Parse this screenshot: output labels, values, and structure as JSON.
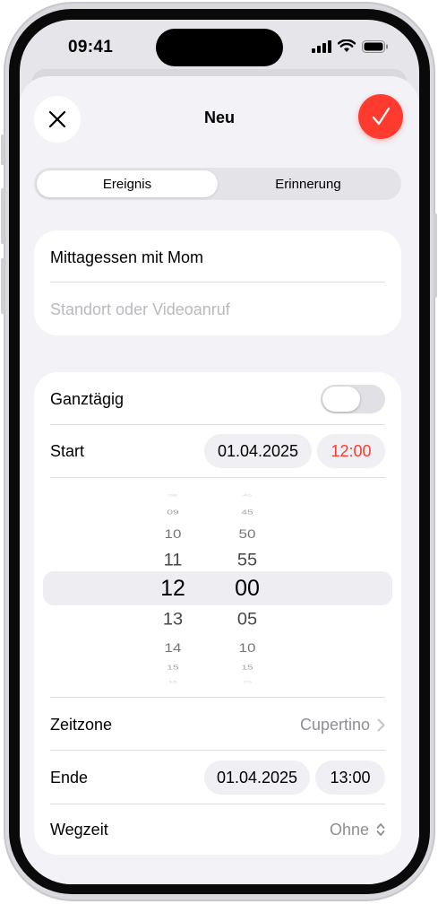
{
  "status": {
    "time": "09:41"
  },
  "nav": {
    "title": "Neu"
  },
  "segments": [
    "Ereignis",
    "Erinnerung"
  ],
  "event": {
    "title_value": "Mittagessen mit Mom",
    "location_placeholder": "Standort oder Videoanruf"
  },
  "allday": {
    "label": "Ganztägig",
    "on": false
  },
  "start": {
    "label": "Start",
    "date": "01.04.2025",
    "time": "12:00"
  },
  "picker": {
    "hours": [
      "08",
      "09",
      "10",
      "11",
      "12",
      "13",
      "14",
      "15",
      "16"
    ],
    "minutes": [
      "40",
      "45",
      "50",
      "55",
      "00",
      "05",
      "10",
      "15",
      "20"
    ],
    "selected_hour": "12",
    "selected_minute": "00"
  },
  "timezone": {
    "label": "Zeitzone",
    "value": "Cupertino"
  },
  "end": {
    "label": "Ende",
    "date": "01.04.2025",
    "time": "13:00"
  },
  "travel": {
    "label": "Wegzeit",
    "value": "Ohne"
  },
  "colors": {
    "accent": "#ff3b30",
    "background": "#f2f2f7"
  }
}
